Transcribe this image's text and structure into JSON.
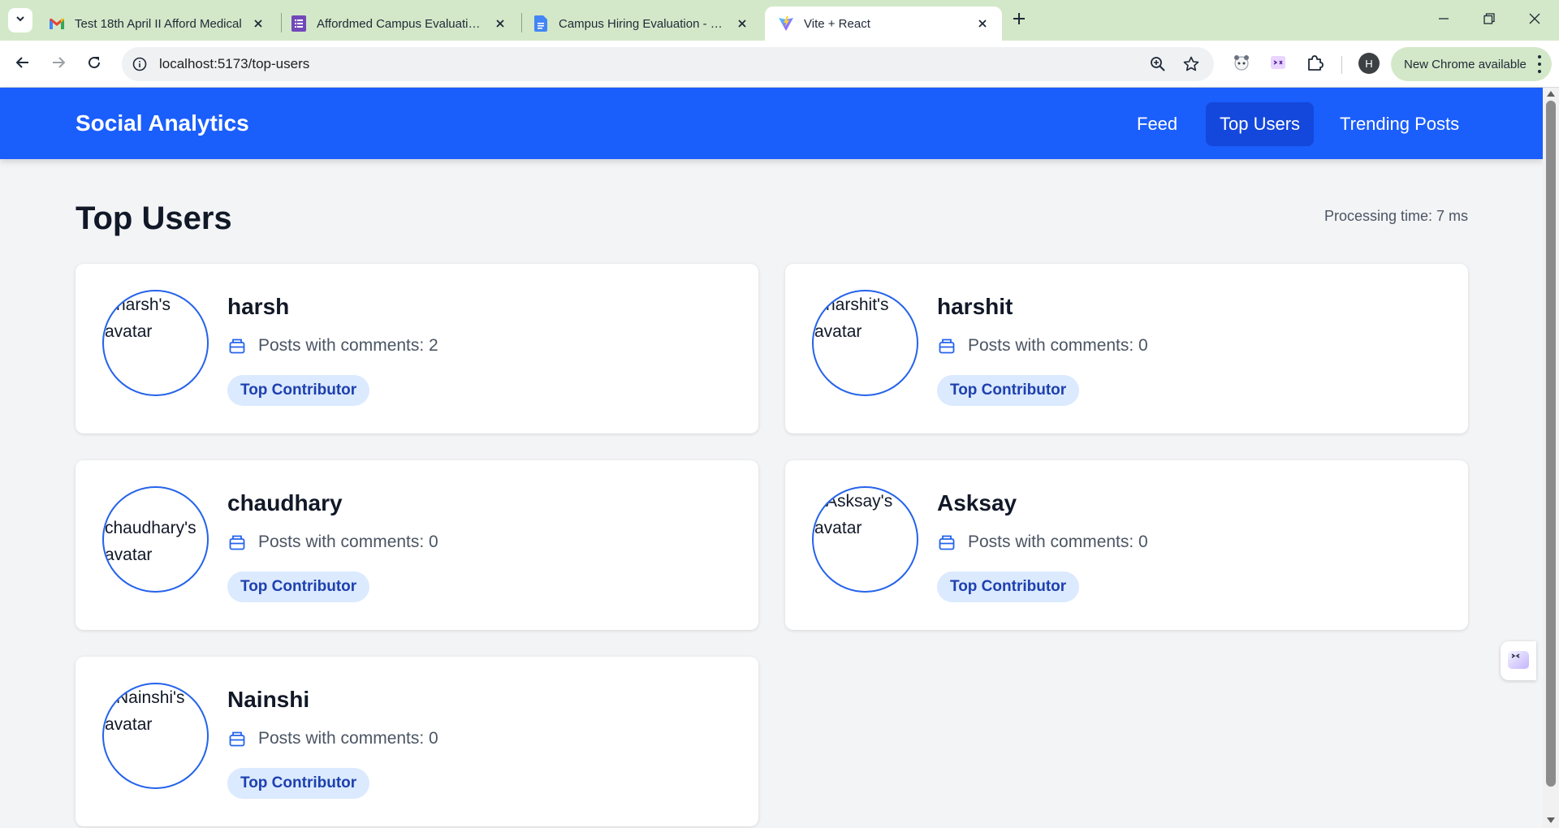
{
  "browser": {
    "tabs": [
      {
        "title": "Test 18th April II Afford Medical",
        "icon": "gmail-icon"
      },
      {
        "title": "Affordmed Campus Evaluation |",
        "icon": "forms-icon"
      },
      {
        "title": "Campus Hiring Evaluation - Full",
        "icon": "docs-icon"
      },
      {
        "title": "Vite + React",
        "icon": "vite-icon",
        "active": true
      }
    ],
    "url": "localhost:5173/top-users",
    "profile_initial": "H",
    "update_chip": "New Chrome available"
  },
  "app": {
    "brand": "Social Analytics",
    "nav": [
      {
        "label": "Feed",
        "active": false
      },
      {
        "label": "Top Users",
        "active": true
      },
      {
        "label": "Trending Posts",
        "active": false
      }
    ],
    "page_title": "Top Users",
    "processing_time": "Processing time: 7 ms",
    "users": [
      {
        "name": "harsh",
        "avatar_alt": "harsh's avatar",
        "posts": "Posts with comments: 2",
        "badge": "Top Contributor"
      },
      {
        "name": "harshit",
        "avatar_alt": "harshit's avatar",
        "posts": "Posts with comments: 0",
        "badge": "Top Contributor"
      },
      {
        "name": "chaudhary",
        "avatar_alt": "chaudhary's avatar",
        "posts": "Posts with comments: 0",
        "badge": "Top Contributor"
      },
      {
        "name": "Asksay",
        "avatar_alt": "Asksay's avatar",
        "posts": "Posts with comments: 0",
        "badge": "Top Contributor"
      },
      {
        "name": "Nainshi",
        "avatar_alt": "Nainshi's avatar",
        "posts": "Posts with comments: 0",
        "badge": "Top Contributor"
      }
    ]
  },
  "colors": {
    "nav_bg": "#1a5efc",
    "nav_active": "#1447db",
    "badge_bg": "#dbeafe",
    "badge_text": "#1e40af",
    "avatar_ring": "#2563eb",
    "page_bg": "#f3f4f6",
    "tabstrip_bg": "#d3e8c8"
  }
}
